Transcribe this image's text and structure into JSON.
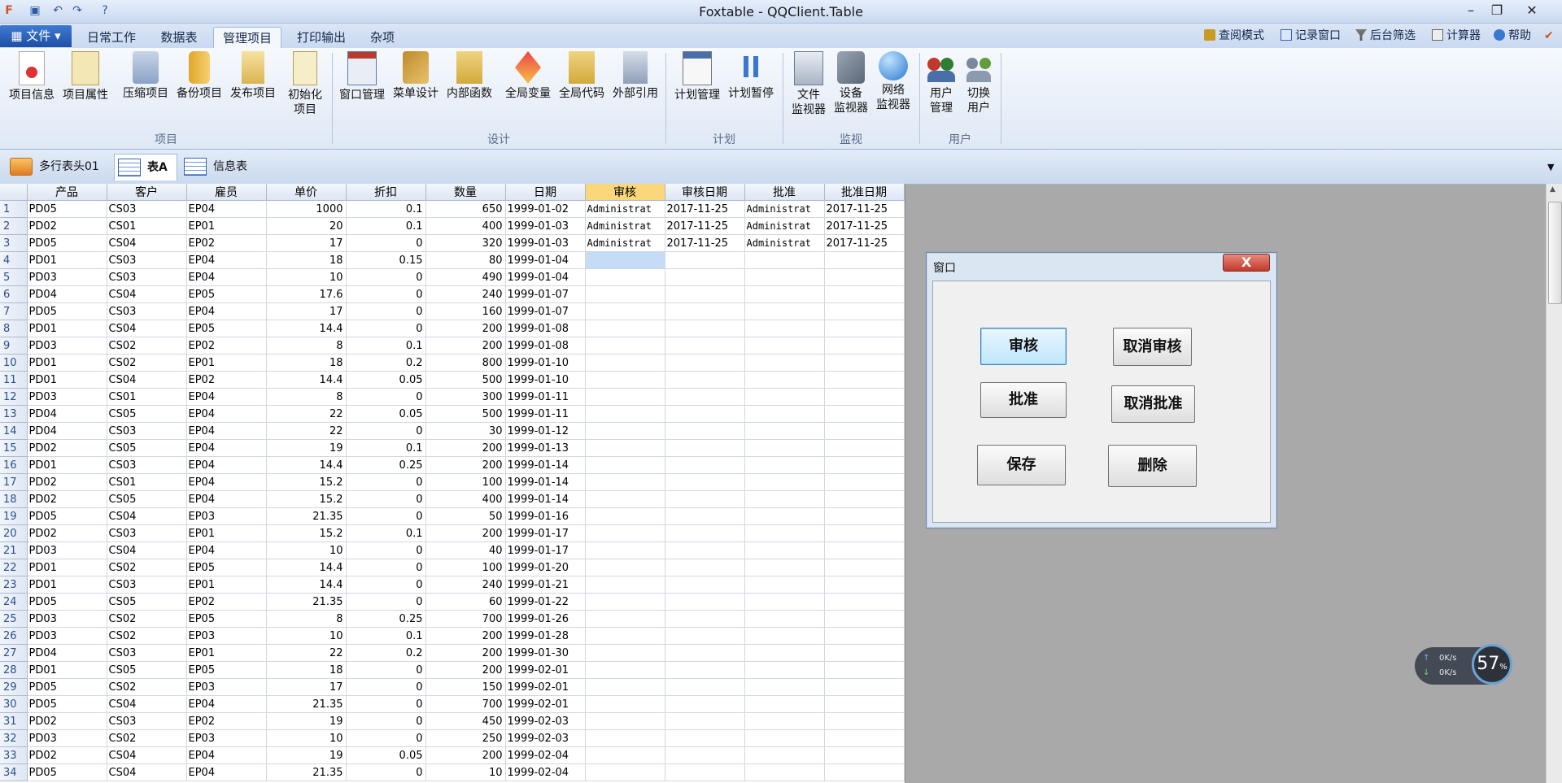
{
  "window": {
    "title": "Foxtable - QQClient.Table"
  },
  "menu": {
    "file_label": "文件",
    "tabs": [
      "日常工作",
      "数据表",
      "管理项目",
      "打印输出",
      "杂项"
    ],
    "active_tab": 2,
    "right_tools": [
      "查阅模式",
      "记录窗口",
      "后台筛选",
      "计算器",
      "帮助"
    ]
  },
  "ribbon": {
    "groups": {
      "project": "项目",
      "design": "设计",
      "plan": "计划",
      "monitor": "监视",
      "user": "用户"
    },
    "buttons": {
      "project_info": "项目信息",
      "project_props": "项目属性",
      "compress": "压缩项目",
      "backup": "备份项目",
      "publish": "发布项目",
      "init1": "初始化",
      "init2": "项目",
      "window_mgr": "窗口管理",
      "menu_design": "菜单设计",
      "internal_func": "内部函数",
      "global_var": "全局变量",
      "global_code": "全局代码",
      "external_ref": "外部引用",
      "plan_mgr": "计划管理",
      "plan_pause": "计划暂停",
      "file_mon1": "文件",
      "file_mon2": "监视器",
      "dev_mon1": "设备",
      "dev_mon2": "监视器",
      "net_mon1": "网络",
      "net_mon2": "监视器",
      "user_mgr1": "用户",
      "user_mgr2": "管理",
      "switch_user1": "切换",
      "switch_user2": "用户"
    }
  },
  "doc_tabs": [
    "多行表头01",
    "表A",
    "信息表"
  ],
  "table": {
    "columns": [
      "产品",
      "客户",
      "雇员",
      "单价",
      "折扣",
      "数量",
      "日期",
      "审核",
      "审核日期",
      "批准",
      "批准日期"
    ],
    "rows": [
      [
        "PD05",
        "CS03",
        "EP04",
        "1000",
        "0.1",
        "650",
        "1999-01-02",
        "Administrat",
        "2017-11-25",
        "Administrat",
        "2017-11-25"
      ],
      [
        "PD02",
        "CS01",
        "EP01",
        "20",
        "0.1",
        "400",
        "1999-01-03",
        "Administrat",
        "2017-11-25",
        "Administrat",
        "2017-11-25"
      ],
      [
        "PD05",
        "CS04",
        "EP02",
        "17",
        "0",
        "320",
        "1999-01-03",
        "Administrat",
        "2017-11-25",
        "Administrat",
        "2017-11-25"
      ],
      [
        "PD01",
        "CS03",
        "EP04",
        "18",
        "0.15",
        "80",
        "1999-01-04",
        "",
        "",
        "",
        ""
      ],
      [
        "PD03",
        "CS03",
        "EP04",
        "10",
        "0",
        "490",
        "1999-01-04",
        "",
        "",
        "",
        ""
      ],
      [
        "PD04",
        "CS04",
        "EP05",
        "17.6",
        "0",
        "240",
        "1999-01-07",
        "",
        "",
        "",
        ""
      ],
      [
        "PD05",
        "CS03",
        "EP04",
        "17",
        "0",
        "160",
        "1999-01-07",
        "",
        "",
        "",
        ""
      ],
      [
        "PD01",
        "CS04",
        "EP05",
        "14.4",
        "0",
        "200",
        "1999-01-08",
        "",
        "",
        "",
        ""
      ],
      [
        "PD03",
        "CS02",
        "EP02",
        "8",
        "0.1",
        "200",
        "1999-01-08",
        "",
        "",
        "",
        ""
      ],
      [
        "PD01",
        "CS02",
        "EP01",
        "18",
        "0.2",
        "800",
        "1999-01-10",
        "",
        "",
        "",
        ""
      ],
      [
        "PD01",
        "CS04",
        "EP02",
        "14.4",
        "0.05",
        "500",
        "1999-01-10",
        "",
        "",
        "",
        ""
      ],
      [
        "PD03",
        "CS01",
        "EP04",
        "8",
        "0",
        "300",
        "1999-01-11",
        "",
        "",
        "",
        ""
      ],
      [
        "PD04",
        "CS05",
        "EP04",
        "22",
        "0.05",
        "500",
        "1999-01-11",
        "",
        "",
        "",
        ""
      ],
      [
        "PD04",
        "CS03",
        "EP04",
        "22",
        "0",
        "30",
        "1999-01-12",
        "",
        "",
        "",
        ""
      ],
      [
        "PD02",
        "CS05",
        "EP04",
        "19",
        "0.1",
        "200",
        "1999-01-13",
        "",
        "",
        "",
        ""
      ],
      [
        "PD01",
        "CS03",
        "EP04",
        "14.4",
        "0.25",
        "200",
        "1999-01-14",
        "",
        "",
        "",
        ""
      ],
      [
        "PD02",
        "CS01",
        "EP04",
        "15.2",
        "0",
        "100",
        "1999-01-14",
        "",
        "",
        "",
        ""
      ],
      [
        "PD02",
        "CS05",
        "EP04",
        "15.2",
        "0",
        "400",
        "1999-01-14",
        "",
        "",
        "",
        ""
      ],
      [
        "PD05",
        "CS04",
        "EP03",
        "21.35",
        "0",
        "50",
        "1999-01-16",
        "",
        "",
        "",
        ""
      ],
      [
        "PD02",
        "CS03",
        "EP01",
        "15.2",
        "0.1",
        "200",
        "1999-01-17",
        "",
        "",
        "",
        ""
      ],
      [
        "PD03",
        "CS04",
        "EP04",
        "10",
        "0",
        "40",
        "1999-01-17",
        "",
        "",
        "",
        ""
      ],
      [
        "PD01",
        "CS02",
        "EP05",
        "14.4",
        "0",
        "100",
        "1999-01-20",
        "",
        "",
        "",
        ""
      ],
      [
        "PD01",
        "CS03",
        "EP01",
        "14.4",
        "0",
        "240",
        "1999-01-21",
        "",
        "",
        "",
        ""
      ],
      [
        "PD05",
        "CS05",
        "EP02",
        "21.35",
        "0",
        "60",
        "1999-01-22",
        "",
        "",
        "",
        ""
      ],
      [
        "PD03",
        "CS02",
        "EP05",
        "8",
        "0.25",
        "700",
        "1999-01-26",
        "",
        "",
        "",
        ""
      ],
      [
        "PD03",
        "CS02",
        "EP03",
        "10",
        "0.1",
        "200",
        "1999-01-28",
        "",
        "",
        "",
        ""
      ],
      [
        "PD04",
        "CS03",
        "EP01",
        "22",
        "0.2",
        "200",
        "1999-01-30",
        "",
        "",
        "",
        ""
      ],
      [
        "PD01",
        "CS05",
        "EP05",
        "18",
        "0",
        "200",
        "1999-02-01",
        "",
        "",
        "",
        ""
      ],
      [
        "PD05",
        "CS02",
        "EP03",
        "17",
        "0",
        "150",
        "1999-02-01",
        "",
        "",
        "",
        ""
      ],
      [
        "PD05",
        "CS04",
        "EP04",
        "21.35",
        "0",
        "700",
        "1999-02-01",
        "",
        "",
        "",
        ""
      ],
      [
        "PD02",
        "CS03",
        "EP02",
        "19",
        "0",
        "450",
        "1999-02-03",
        "",
        "",
        "",
        ""
      ],
      [
        "PD03",
        "CS02",
        "EP03",
        "10",
        "0",
        "250",
        "1999-02-03",
        "",
        "",
        "",
        ""
      ],
      [
        "PD02",
        "CS04",
        "EP04",
        "19",
        "0.05",
        "200",
        "1999-02-04",
        "",
        "",
        "",
        ""
      ],
      [
        "PD05",
        "CS04",
        "EP04",
        "21.35",
        "0",
        "10",
        "1999-02-04",
        "",
        "",
        "",
        ""
      ]
    ]
  },
  "dialog": {
    "title": "窗口",
    "close": "X",
    "buttons": {
      "audit": "审核",
      "cancel_audit": "取消审核",
      "approve": "批准",
      "cancel_approve": "取消批准",
      "save": "保存",
      "delete": "删除"
    }
  },
  "net_widget": {
    "up": "0K/s",
    "down": "0K/s",
    "percent": "57",
    "percent_unit": "%"
  },
  "colors": {
    "accent": "#1d4fa5",
    "selected_header": "#f9d77a",
    "current_cell": "#c5dcf7"
  }
}
